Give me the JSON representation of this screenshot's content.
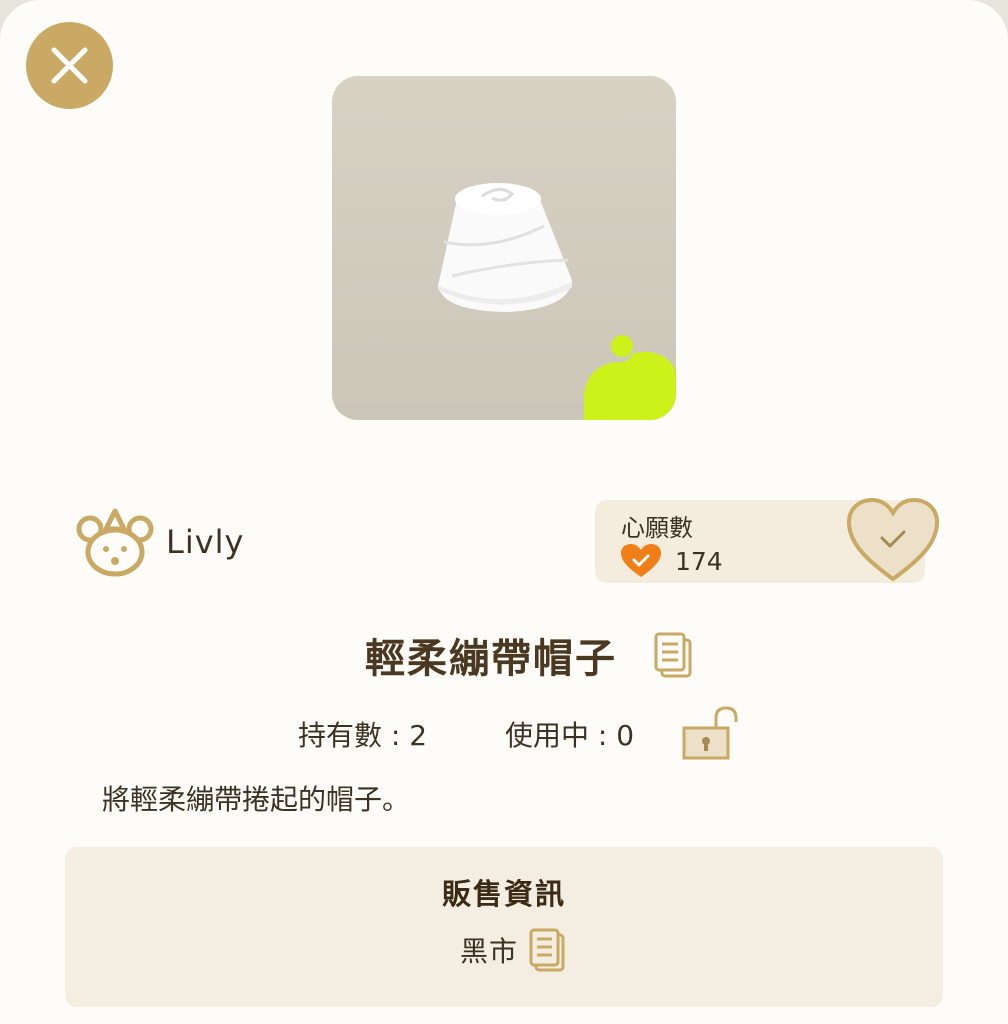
{
  "close": {
    "icon": "close-icon"
  },
  "item": {
    "title": "輕柔繃帶帽子",
    "description": "將輕柔繃帶捲起的帽子。",
    "image_icon": "bandage-hat-icon"
  },
  "brand": {
    "name": "Livly",
    "icon": "livly-bear-icon"
  },
  "wishlist": {
    "title": "心願數",
    "count": "174",
    "count_icon": "orange-heart-check-icon",
    "button_icon": "heart-check-icon"
  },
  "stats": {
    "owned": "持有數 : 2",
    "in_use": "使用中 : 0",
    "lock_icon": "unlocked-padlock-icon"
  },
  "sales": {
    "title": "販售資訊",
    "value": "黑市",
    "copy_icon": "document-icon"
  },
  "colors": {
    "accent": "#c9a964",
    "title_brown": "#4a3820",
    "orange": "#f07f1a",
    "lime": "#ccf21a"
  }
}
